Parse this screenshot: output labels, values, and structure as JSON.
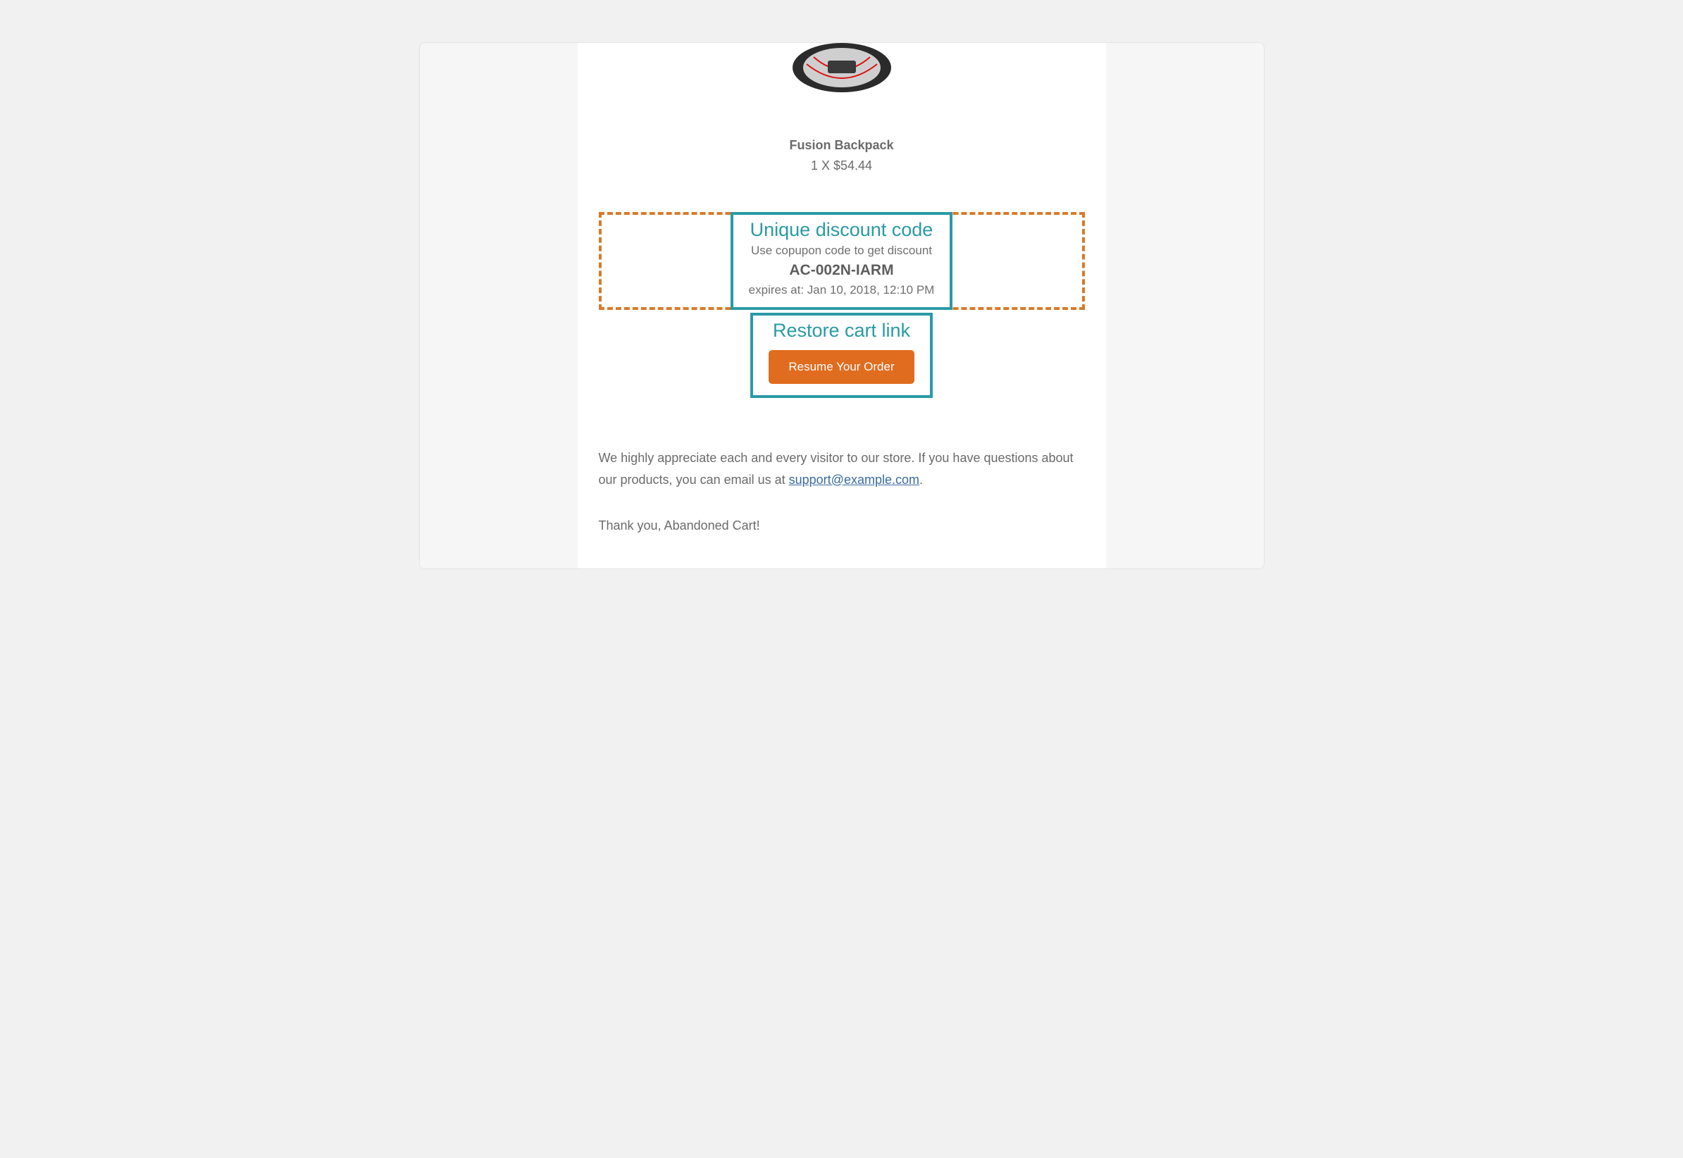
{
  "product": {
    "name": "Fusion Backpack",
    "price_line": "1 X $54.44"
  },
  "coupon": {
    "callout_title": "Unique discount code",
    "instruction": "Use copupon code to get discount",
    "code": "AC-002N-IARM",
    "expiry": "expires at: Jan 10, 2018, 12:10 PM"
  },
  "restore": {
    "callout_title": "Restore cart link",
    "button_label": "Resume Your Order"
  },
  "body": {
    "text_before_link": "We highly appreciate each and every visitor to our store. If you have questions about our products, you can email us at ",
    "link_text": "support@example.com",
    "text_after_link": "."
  },
  "signoff": "Thank you, Abandoned Cart!"
}
